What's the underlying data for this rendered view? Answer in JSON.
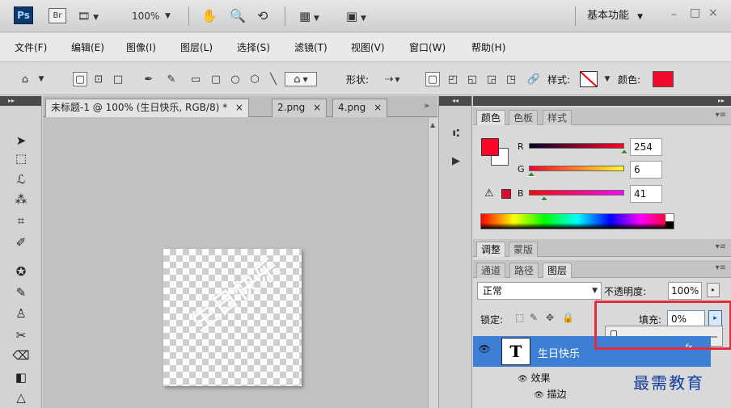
{
  "titlebar": {
    "ps_logo": "Ps",
    "br_logo": "Br",
    "zoom": "100%",
    "workspace": "基本功能",
    "minimize": "–",
    "restore": "□",
    "close": "×"
  },
  "menubar": {
    "items": [
      {
        "label": "文件(F)"
      },
      {
        "label": "编辑(E)"
      },
      {
        "label": "图像(I)"
      },
      {
        "label": "图层(L)"
      },
      {
        "label": "选择(S)"
      },
      {
        "label": "滤镜(T)"
      },
      {
        "label": "视图(V)"
      },
      {
        "label": "窗口(W)"
      },
      {
        "label": "帮助(H)"
      }
    ]
  },
  "options": {
    "shape_label": "形状:",
    "style_label": "样式:",
    "color_label": "颜色:",
    "fill_color": "#f20a2b"
  },
  "document": {
    "tabs": [
      {
        "label": "未标题-1 @ 100% (生日快乐, RGB/8) *"
      },
      {
        "label": "2.png"
      },
      {
        "label": "4.png"
      }
    ],
    "tab_close": "×",
    "tab_more": "»",
    "canvas_text": "生日快乐"
  },
  "color_panel": {
    "tabs": [
      {
        "label": "颜色"
      },
      {
        "label": "色板"
      },
      {
        "label": "样式"
      }
    ],
    "foreground": "#fe0629",
    "channels": [
      {
        "name": "R",
        "value": "254",
        "fraction": 0.996,
        "gradient": "linear-gradient(90deg,#000629,#ff0629)"
      },
      {
        "name": "G",
        "value": "6",
        "fraction": 0.024,
        "gradient": "linear-gradient(90deg,#fe0029,#feff29)"
      },
      {
        "name": "B",
        "value": "41",
        "fraction": 0.161,
        "gradient": "linear-gradient(90deg,#fe0600,#fe06ff)"
      }
    ],
    "warning_icon": "⚠"
  },
  "adjust_panel": {
    "tabs": [
      {
        "label": "调整"
      },
      {
        "label": "蒙版"
      }
    ]
  },
  "layers_panel": {
    "tabs": [
      {
        "label": "通道"
      },
      {
        "label": "路径"
      },
      {
        "label": "图层"
      }
    ],
    "blend_mode": "正常",
    "opacity_label": "不透明度:",
    "opacity_value": "100%",
    "lock_label": "锁定:",
    "fill_label": "填充:",
    "fill_value": "0%",
    "fill_fraction": 0,
    "layer": {
      "name": "生日快乐",
      "thumb": "T",
      "fx": "fx"
    },
    "effects": [
      {
        "label": "效果"
      },
      {
        "label": "描边"
      }
    ]
  },
  "watermark": "最需教育",
  "colors": {
    "highlight": "#e52a3c",
    "selection": "#3d7fd4"
  }
}
